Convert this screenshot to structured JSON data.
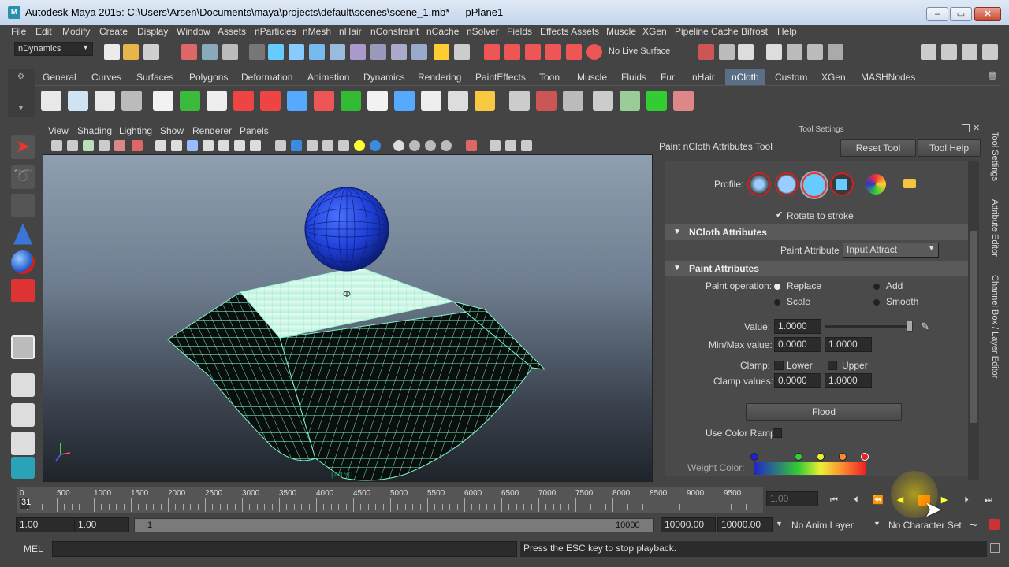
{
  "window": {
    "title": "Autodesk Maya 2015: C:\\Users\\Arsen\\Documents\\maya\\projects\\default\\scenes\\scene_1.mb*  ---  pPlane1",
    "minimize": "‒",
    "maximize": "▭",
    "close": "✕"
  },
  "menu": [
    "File",
    "Edit",
    "Modify",
    "Create",
    "Display",
    "Window",
    "Assets",
    "nParticles",
    "nMesh",
    "nHair",
    "nConstraint",
    "nCache",
    "nSolver",
    "Fields",
    "Effects Assets",
    "Muscle",
    "XGen",
    "Pipeline Cache",
    "Bifrost",
    "Help"
  ],
  "statusline": {
    "menuset": "nDynamics",
    "live_surface": "No Live Surface"
  },
  "shelf_tabs": [
    "General",
    "Curves",
    "Surfaces",
    "Polygons",
    "Deformation",
    "Animation",
    "Dynamics",
    "Rendering",
    "PaintEffects",
    "Toon",
    "Muscle",
    "Fluids",
    "Fur",
    "nHair",
    "nCloth",
    "Custom",
    "XGen",
    "MASHNodes"
  ],
  "shelf_active": "nCloth",
  "viewport": {
    "menus": [
      "View",
      "Shading",
      "Lighting",
      "Show",
      "Renderer",
      "Panels"
    ],
    "camera_label": "persp"
  },
  "tool_settings": {
    "header": "Tool Settings",
    "tool_name": "Paint nCloth Attributes Tool",
    "reset_button": "Reset Tool",
    "help_button": "Tool Help",
    "profile_label": "Profile:",
    "rotate_to_stroke": "Rotate to stroke",
    "ncloth_section": "NCloth Attributes",
    "paint_attribute_label": "Paint Attribute",
    "paint_attribute_value": "Input Attract",
    "paint_section": "Paint Attributes",
    "paint_operation_label": "Paint operation:",
    "op_replace": "Replace",
    "op_add": "Add",
    "op_scale": "Scale",
    "op_smooth": "Smooth",
    "selected_operation": "Replace",
    "value_label": "Value:",
    "value": "1.0000",
    "value_slider_level": 1.0,
    "minmax_label": "Min/Max value:",
    "min_value": "0.0000",
    "max_value": "1.0000",
    "clamp_label": "Clamp:",
    "clamp_lower": "Lower",
    "clamp_upper": "Upper",
    "clamp_values_label": "Clamp values:",
    "clamp_min": "0.0000",
    "clamp_max": "1.0000",
    "flood_button": "Flood",
    "use_color_ramp": "Use Color Ramp",
    "weight_color_label": "Weight Color:"
  },
  "side_tabs": [
    "Tool Settings",
    "Attribute Editor",
    "Channel Box / Layer Editor"
  ],
  "timeline": {
    "ticks": [
      "0",
      "500",
      "1000",
      "1500",
      "2000",
      "2500",
      "3000",
      "3500",
      "4000",
      "4500",
      "5000",
      "5500",
      "6000",
      "6500",
      "7000",
      "7500",
      "8000",
      "8500",
      "9000",
      "9500"
    ],
    "current_frame": "31",
    "current_time_field": "1.00"
  },
  "range": {
    "start": "1.00",
    "playback_start": "1.00",
    "slider_start": "1",
    "slider_end": "10000",
    "playback_end": "10000.00",
    "end": "10000.00",
    "anim_layer": "No Anim Layer",
    "character_set": "No Character Set"
  },
  "command": {
    "mode": "MEL",
    "help_line": "Press the ESC key to stop playback."
  },
  "colors": {
    "accent_tab": "#5a6f86",
    "mesh_wire": "#7df5c8",
    "sphere": "#1f3fd6"
  }
}
